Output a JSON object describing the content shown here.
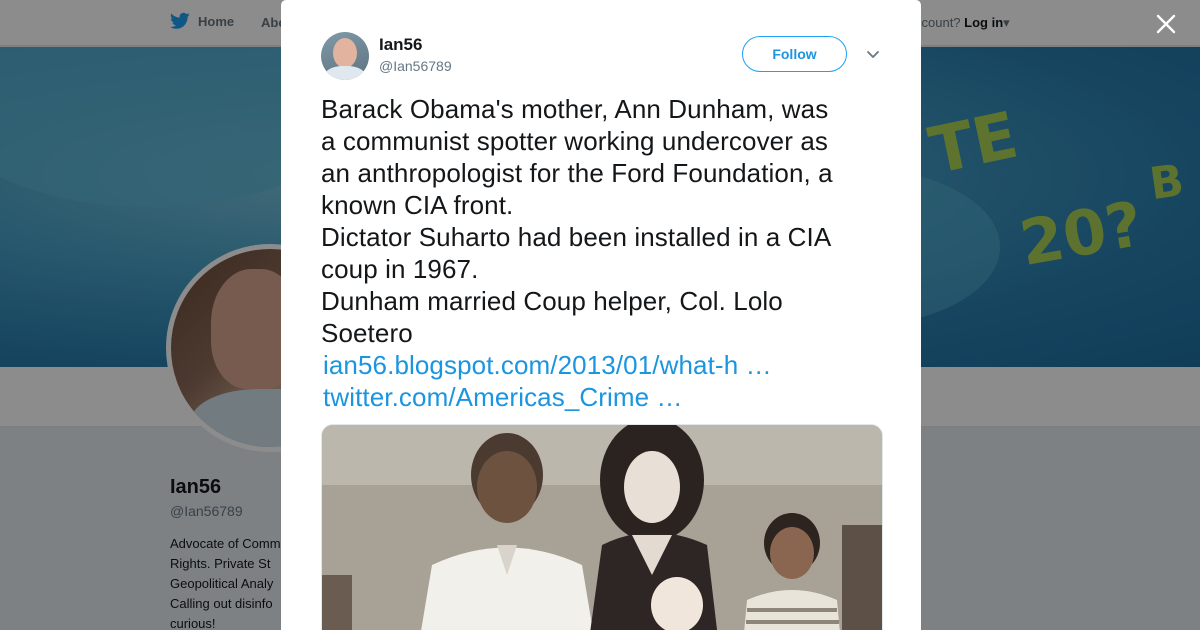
{
  "background_page": {
    "nav": {
      "home_label": "Home",
      "about_label": "Abo",
      "account_prompt": "ccount?",
      "login_label": "Log in"
    },
    "profile": {
      "name": "Ian56",
      "handle": "@Ian56789",
      "bio_lines": [
        "Advocate of Comm",
        "Rights. Private St",
        "Geopolitical Analy",
        "Calling out disinfo",
        "curious!"
      ]
    },
    "banner_text": [
      "TE",
      "20?",
      "B"
    ]
  },
  "modal": {
    "author": {
      "name": "Ian56",
      "handle": "@Ian56789"
    },
    "follow_label": "Follow",
    "tweet_lines": [
      "Barack Obama's mother, Ann Dunham, was",
      "a communist spotter working undercover as",
      "an anthropologist for the Ford Foundation, a",
      "known CIA front.",
      "Dictator Suharto had been installed in a CIA",
      "coup in 1967.",
      "Dunham married Coup helper, Col. Lolo",
      "Soetero"
    ],
    "links": [
      "ian56.blogspot.com/2013/01/what-h …",
      "twitter.com/Americas_Crime …"
    ]
  },
  "icons": {
    "twitter_bird": "twitter-bird-icon",
    "close": "close-icon",
    "caret": "chevron-down-icon"
  },
  "colors": {
    "accent": "#1da1f2",
    "link": "#1b95e0",
    "text": "#14171a",
    "muted": "#657786"
  }
}
